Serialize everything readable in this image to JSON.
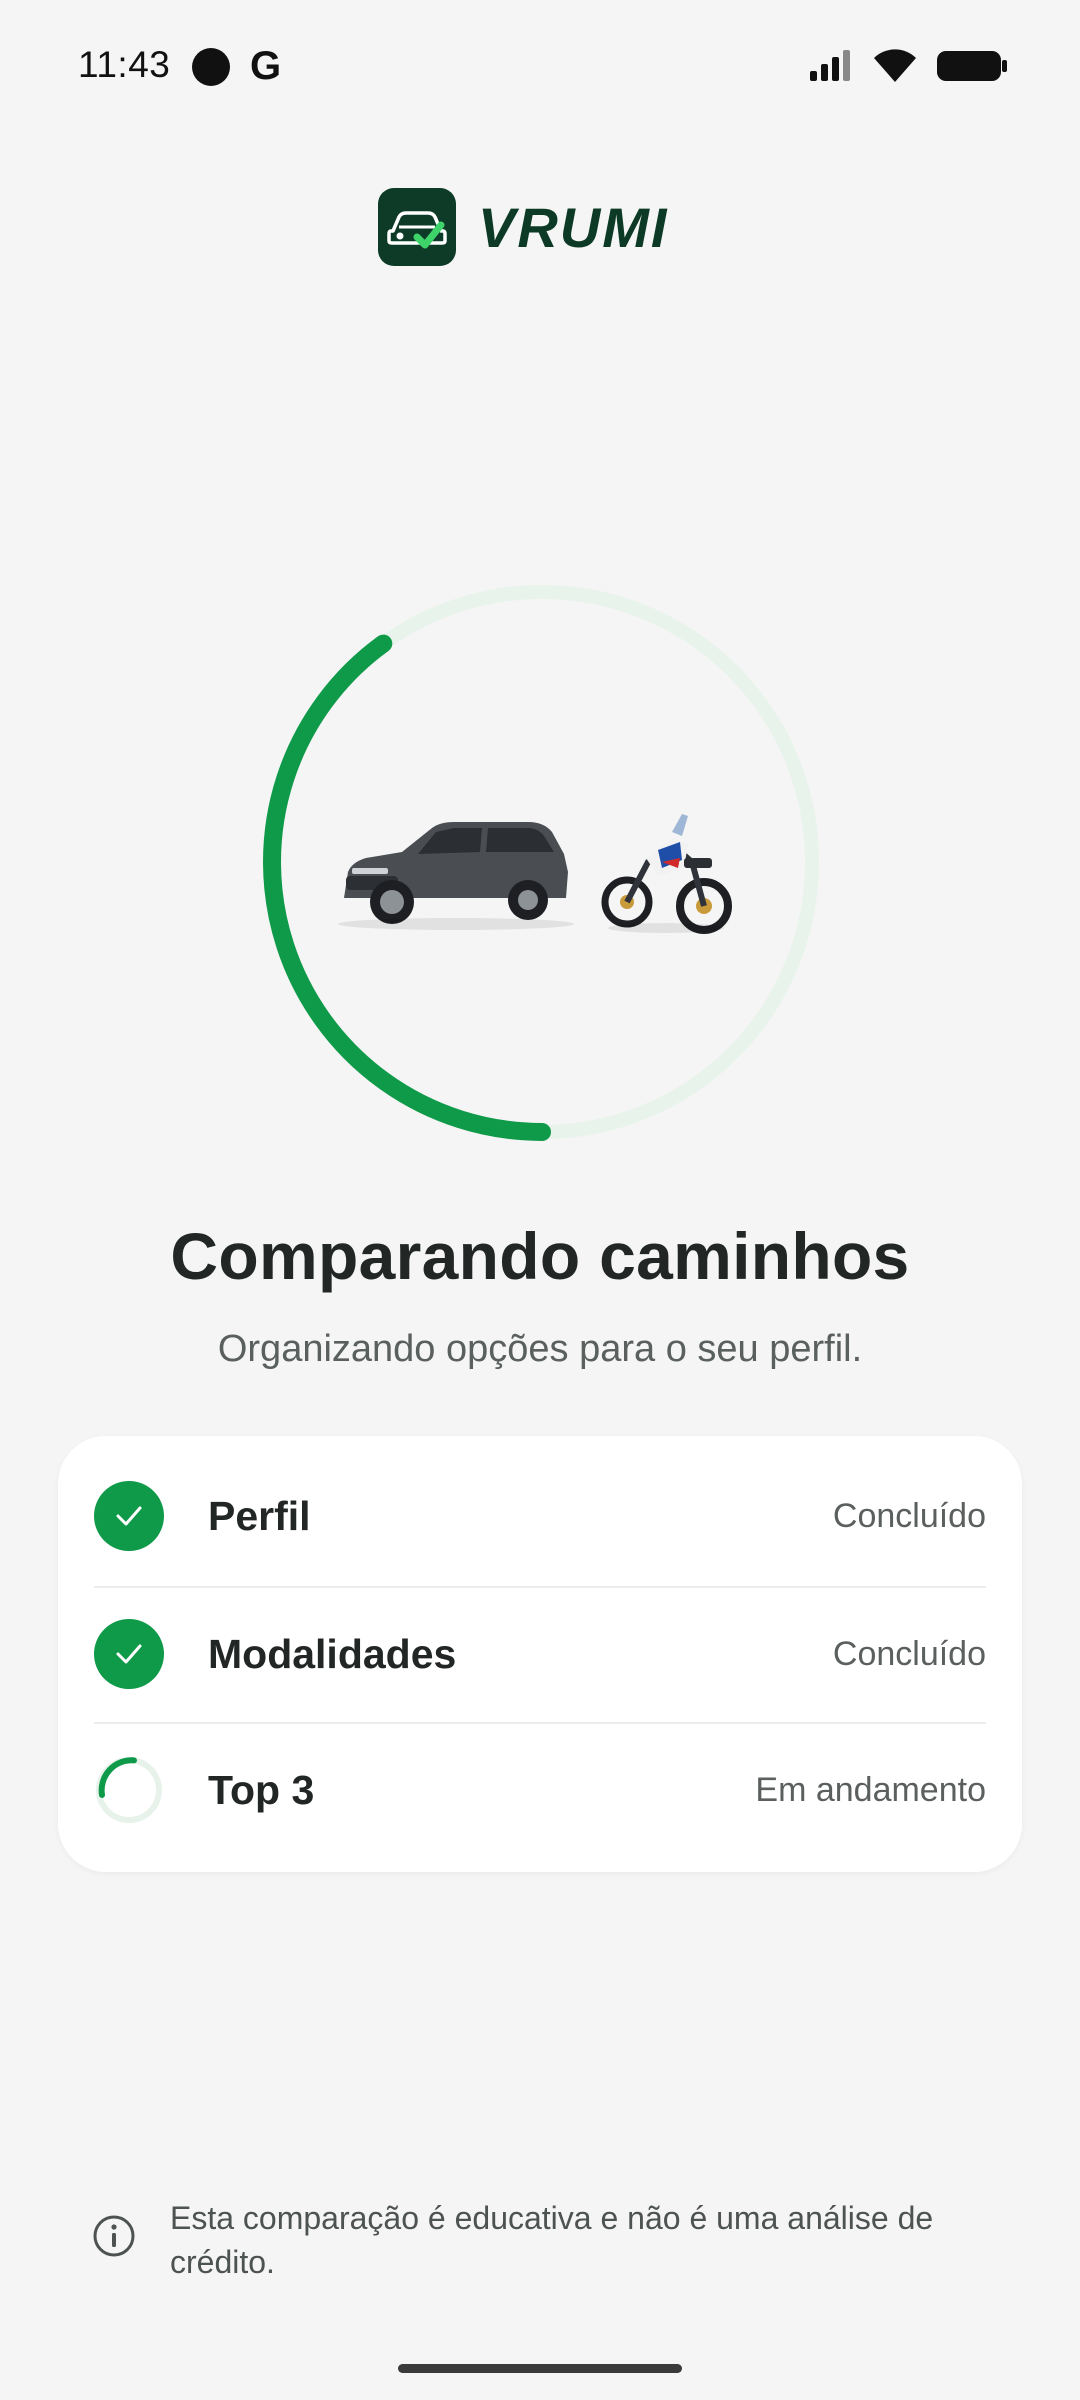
{
  "status_bar": {
    "time": "11:43",
    "g_label": "G"
  },
  "brand": {
    "name": "VRUMI",
    "color": "#0c3a26",
    "accent": "#0f9a4a"
  },
  "progress": {
    "value": 0.4
  },
  "header": {
    "title": "Comparando caminhos",
    "subtitle": "Organizando opções para o seu perfil."
  },
  "steps": [
    {
      "label": "Perfil",
      "status": "Concluído",
      "state": "done"
    },
    {
      "label": "Modalidades",
      "status": "Concluído",
      "state": "done"
    },
    {
      "label": "Top 3",
      "status": "Em andamento",
      "state": "in-progress"
    }
  ],
  "disclaimer": {
    "text": "Esta comparação é educativa e não é uma análise de crédito."
  }
}
